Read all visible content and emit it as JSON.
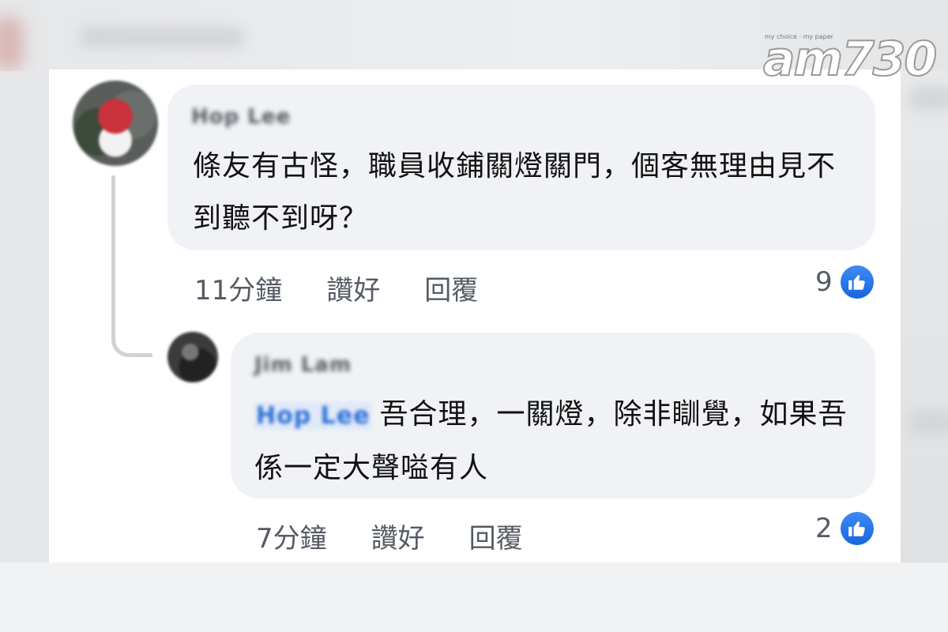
{
  "logo": {
    "text": "am730",
    "tagline": "my choice · my paper"
  },
  "comments": [
    {
      "author": "Hop Lee",
      "body": "條友有古怪，職員收鋪關燈關門，個客無理由見不到聽不到呀？",
      "time": "11分鐘",
      "like_label": "讚好",
      "reply_label": "回覆",
      "like_count": "9"
    },
    {
      "author": "Jim Lam",
      "mention": "Hop Lee",
      "body": "吾合理，一關燈，除非瞓覺，如果吾係一定大聲嗌有人",
      "time": "7分鐘",
      "like_label": "讚好",
      "reply_label": "回覆",
      "like_count": "2"
    }
  ],
  "colors": {
    "bubble": "#f0f2f5",
    "like_blue": "#1877f2",
    "mention_blue": "#2d6fd6"
  }
}
